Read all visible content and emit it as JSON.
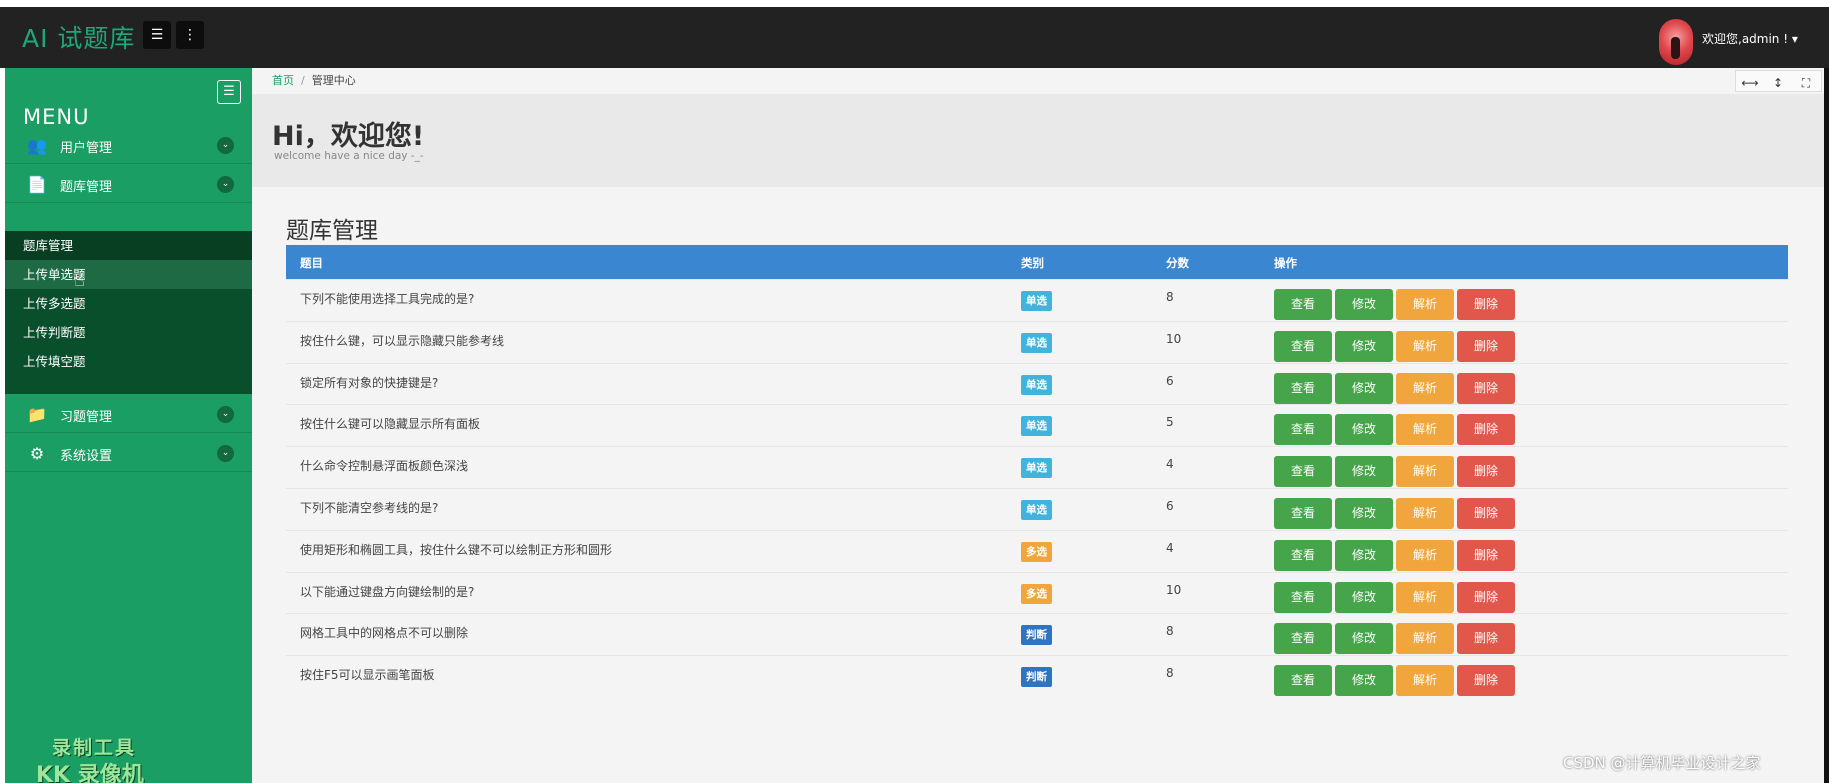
{
  "app": {
    "brand": "AI 试题库",
    "user_greeting": "欢迎您,admin ! ▾"
  },
  "toolbar": {
    "hamburger_icon": "☰",
    "more_icon": "⋮"
  },
  "sidebar": {
    "menu_title": "MENU",
    "collapse_icon": "☰",
    "items": [
      {
        "label": "用户管理",
        "icon": "👥"
      },
      {
        "label": "题库管理",
        "icon": "📄"
      },
      {
        "label": "习题管理",
        "icon": "📁"
      },
      {
        "label": "系统设置",
        "icon": "⚙"
      }
    ],
    "submenu": [
      "题库管理",
      "上传单选题",
      "上传多选题",
      "上传判断题",
      "上传填空题"
    ],
    "chevron": "⌄"
  },
  "breadcrumb": {
    "home": "首页",
    "sep": "/",
    "current": "管理中心"
  },
  "window_controls": {
    "h": "⟷",
    "v": "↕",
    "full": "⛶"
  },
  "hero": {
    "title": "Hi，欢迎您!",
    "subtitle": "welcome have a nice day -_-"
  },
  "section": {
    "title": "题库管理"
  },
  "table": {
    "headers": {
      "question": "题目",
      "type": "类别",
      "score": "分数",
      "actions": "操作"
    },
    "buttons": {
      "view": "查看",
      "edit": "修改",
      "analyze": "解析",
      "delete": "删除"
    },
    "rows": [
      {
        "q": "下列不能使用选择工具完成的是?",
        "type": "单选",
        "score": "8"
      },
      {
        "q": "按住什么键，可以显示隐藏只能参考线",
        "type": "单选",
        "score": "10"
      },
      {
        "q": "锁定所有对象的快捷键是?",
        "type": "单选",
        "score": "6"
      },
      {
        "q": "按住什么键可以隐藏显示所有面板",
        "type": "单选",
        "score": "5"
      },
      {
        "q": "什么命令控制悬浮面板颜色深浅",
        "type": "单选",
        "score": "4"
      },
      {
        "q": "下列不能清空参考线的是?",
        "type": "单选",
        "score": "6"
      },
      {
        "q": "使用矩形和椭圆工具，按住什么键不可以绘制正方形和圆形",
        "type": "多选",
        "score": "4"
      },
      {
        "q": "以下能通过键盘方向键绘制的是?",
        "type": "多选",
        "score": "10"
      },
      {
        "q": "网格工具中的网格点不可以删除",
        "type": "判断",
        "score": "8"
      },
      {
        "q": "按住F5可以显示画笔面板",
        "type": "判断",
        "score": "8"
      }
    ]
  },
  "colors": {
    "single": "#41b3dd",
    "multi": "#f0a63c",
    "judge": "#2f74c0"
  },
  "watermark": {
    "recorder_line1": "录制工具",
    "recorder_line2": "KK 录像机",
    "csdn": "CSDN @计算机毕业设计之家"
  }
}
